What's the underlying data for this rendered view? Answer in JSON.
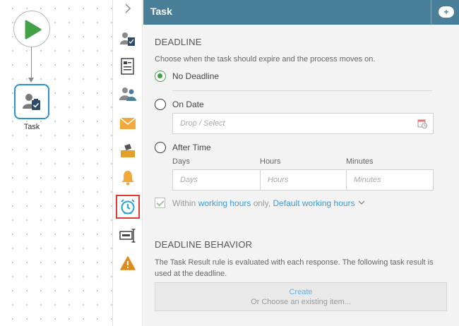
{
  "canvas": {
    "task_label": "Task"
  },
  "toolbar": {
    "collapse_icon": "chevron-right-icon",
    "items": [
      {
        "name": "task-assign-icon"
      },
      {
        "name": "form-icon"
      },
      {
        "name": "users-icon"
      },
      {
        "name": "email-icon"
      },
      {
        "name": "inbox-icon"
      },
      {
        "name": "bell-icon"
      },
      {
        "name": "alarm-clock-icon",
        "selected": true
      },
      {
        "name": "text-field-icon"
      },
      {
        "name": "warning-icon"
      }
    ]
  },
  "panel": {
    "title": "Task",
    "add_icon": "add-icon",
    "deadline": {
      "heading": "DEADLINE",
      "hint": "Choose when the task should expire and the process moves on.",
      "options": [
        "No Deadline",
        "On Date",
        "After Time"
      ],
      "selected_option": "No Deadline",
      "date_placeholder": "Drop / Select",
      "columns": [
        "Days",
        "Hours",
        "Minutes"
      ],
      "placeholders": [
        "Days",
        "Hours",
        "Minutes"
      ],
      "working_hours": {
        "checked": true,
        "prefix": "Within ",
        "link1": "working hours",
        "middle": " only, ",
        "link2": "Default working hours"
      }
    },
    "behavior": {
      "heading": "DEADLINE BEHAVIOR",
      "text": "The Task Result rule is evaluated with each response. The following task result is used at the deadline.",
      "create_label": "Create",
      "choose_label": "Or Choose an existing item..."
    }
  },
  "colors": {
    "header": "#4a7f99",
    "accent_green": "#43a047",
    "link": "#3a9ad9",
    "selected_outline": "#e53935",
    "node_border": "#2b8fd8"
  }
}
